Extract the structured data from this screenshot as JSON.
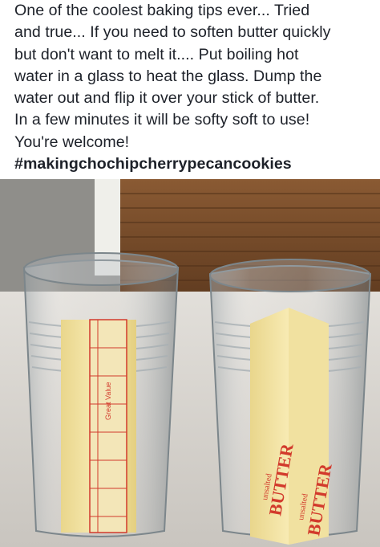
{
  "post": {
    "text_lines": [
      "One of the coolest baking tips ever... Tried",
      "and true... If you need to soften butter quickly",
      "but don't want to melt it.... Put boiling hot",
      "water in a glass to heat the glass. Dump the",
      "water out and flip it over your stick of butter.",
      "In a few minutes it will be softy soft to use!",
      "You're welcome!"
    ],
    "hashtag": "#makingchochipcherrypecancookies"
  },
  "photo": {
    "left_butter": {
      "brand_text": "Great Value"
    },
    "right_butter": {
      "unsalted_label": "unsalted",
      "butter_label": "BUTTER"
    },
    "colors": {
      "cabinet_wood": "#7a4e2b",
      "counter": "#d9d6d1",
      "butter": "#f4e4a3",
      "wrapper_red": "#d23a2c"
    }
  }
}
